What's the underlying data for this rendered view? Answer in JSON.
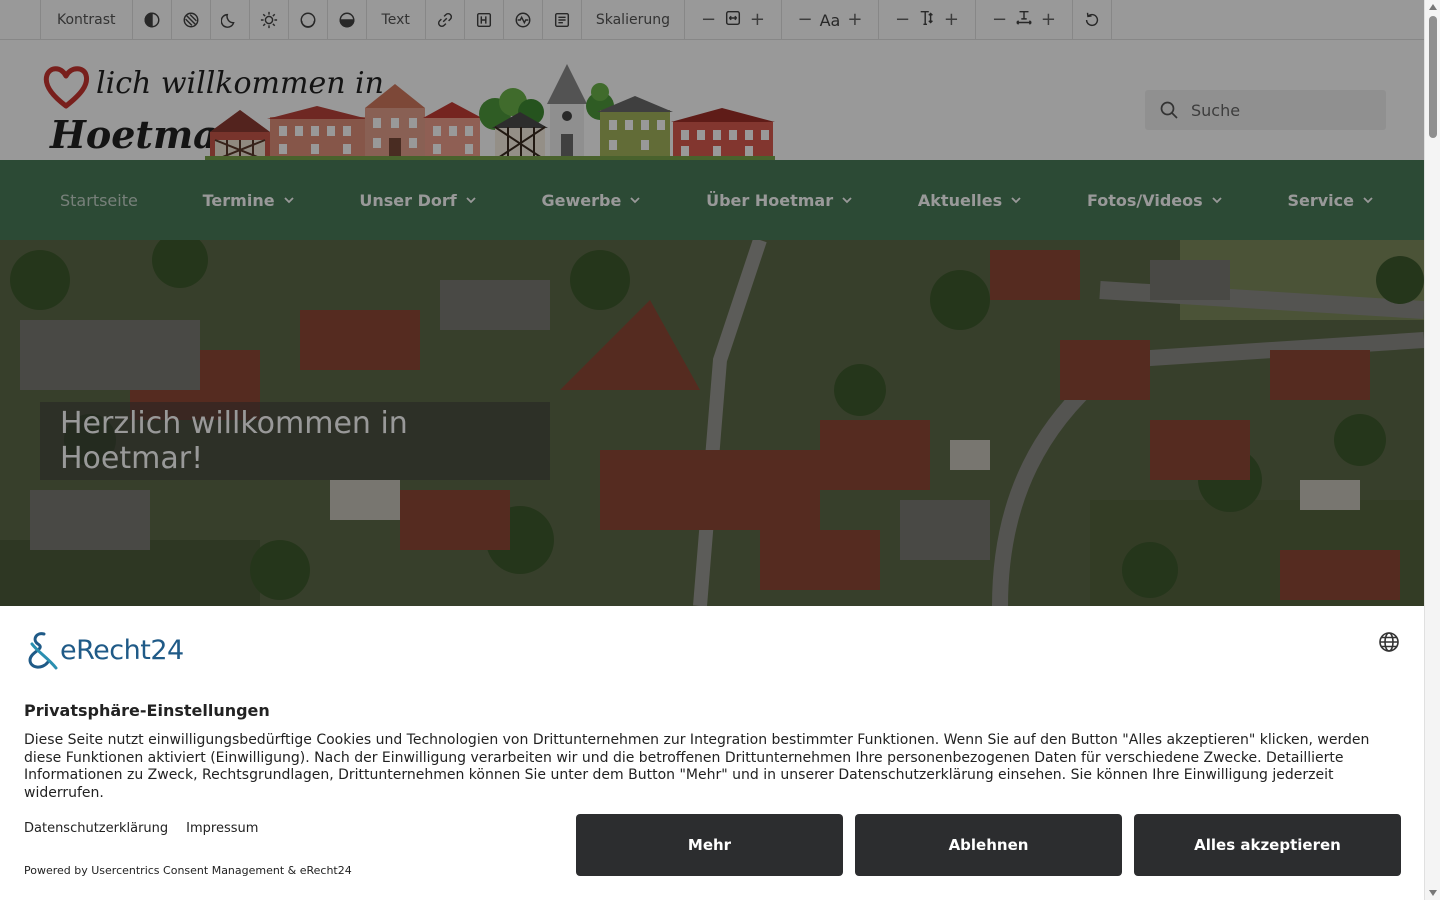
{
  "toolbar": {
    "contrast_label": "Kontrast",
    "text_label": "Text",
    "scaling_label": "Skalierung",
    "font_size_label": "Aa",
    "minus": "−",
    "plus": "+"
  },
  "header": {
    "logo_line1": "lich willkommen in",
    "logo_line2": "Hoetmar",
    "search_placeholder": "Suche"
  },
  "nav": {
    "items": [
      {
        "label": "Startseite"
      },
      {
        "label": "Termine"
      },
      {
        "label": "Unser Dorf"
      },
      {
        "label": "Gewerbe"
      },
      {
        "label": "Über Hoetmar"
      },
      {
        "label": "Aktuelles"
      },
      {
        "label": "Fotos/Videos"
      },
      {
        "label": "Service"
      }
    ]
  },
  "hero": {
    "title": "Herzlich willkommen in Hoetmar!"
  },
  "consent": {
    "brand": "eRecht24",
    "title": "Privatsphäre-Einstellungen",
    "text": "Diese Seite nutzt einwilligungsbedürftige Cookies und Technologien von Drittunternehmen zur Integration bestimmter Funktionen. Wenn Sie auf den Button \"Alles akzeptieren\" klicken, werden diese Funktionen aktiviert (Einwilligung). Nach der Einwilligung verarbeiten wir und die betroffenen Drittunternehmen Ihre personenbezogenen Daten für verschiedene Zwecke. Detaillierte Informationen zu Zweck, Rechtsgrundlagen, Drittunternehmen können Sie unter dem Button \"Mehr\" und in unserer Datenschutzerklärung einsehen. Sie können Ihre Einwilligung jederzeit widerrufen.",
    "link_privacy": "Datenschutzerklärung",
    "link_imprint": "Impressum",
    "powered_by": "Powered by Usercentrics Consent Management & eRecht24",
    "btn_more": "Mehr",
    "btn_deny": "Ablehnen",
    "btn_accept": "Alles akzeptieren"
  },
  "colors": {
    "nav_green": "#4a7c59",
    "button_dark": "#2c2d2f",
    "brand_blue": "#1f5a87",
    "heart_red": "#c8352f"
  }
}
